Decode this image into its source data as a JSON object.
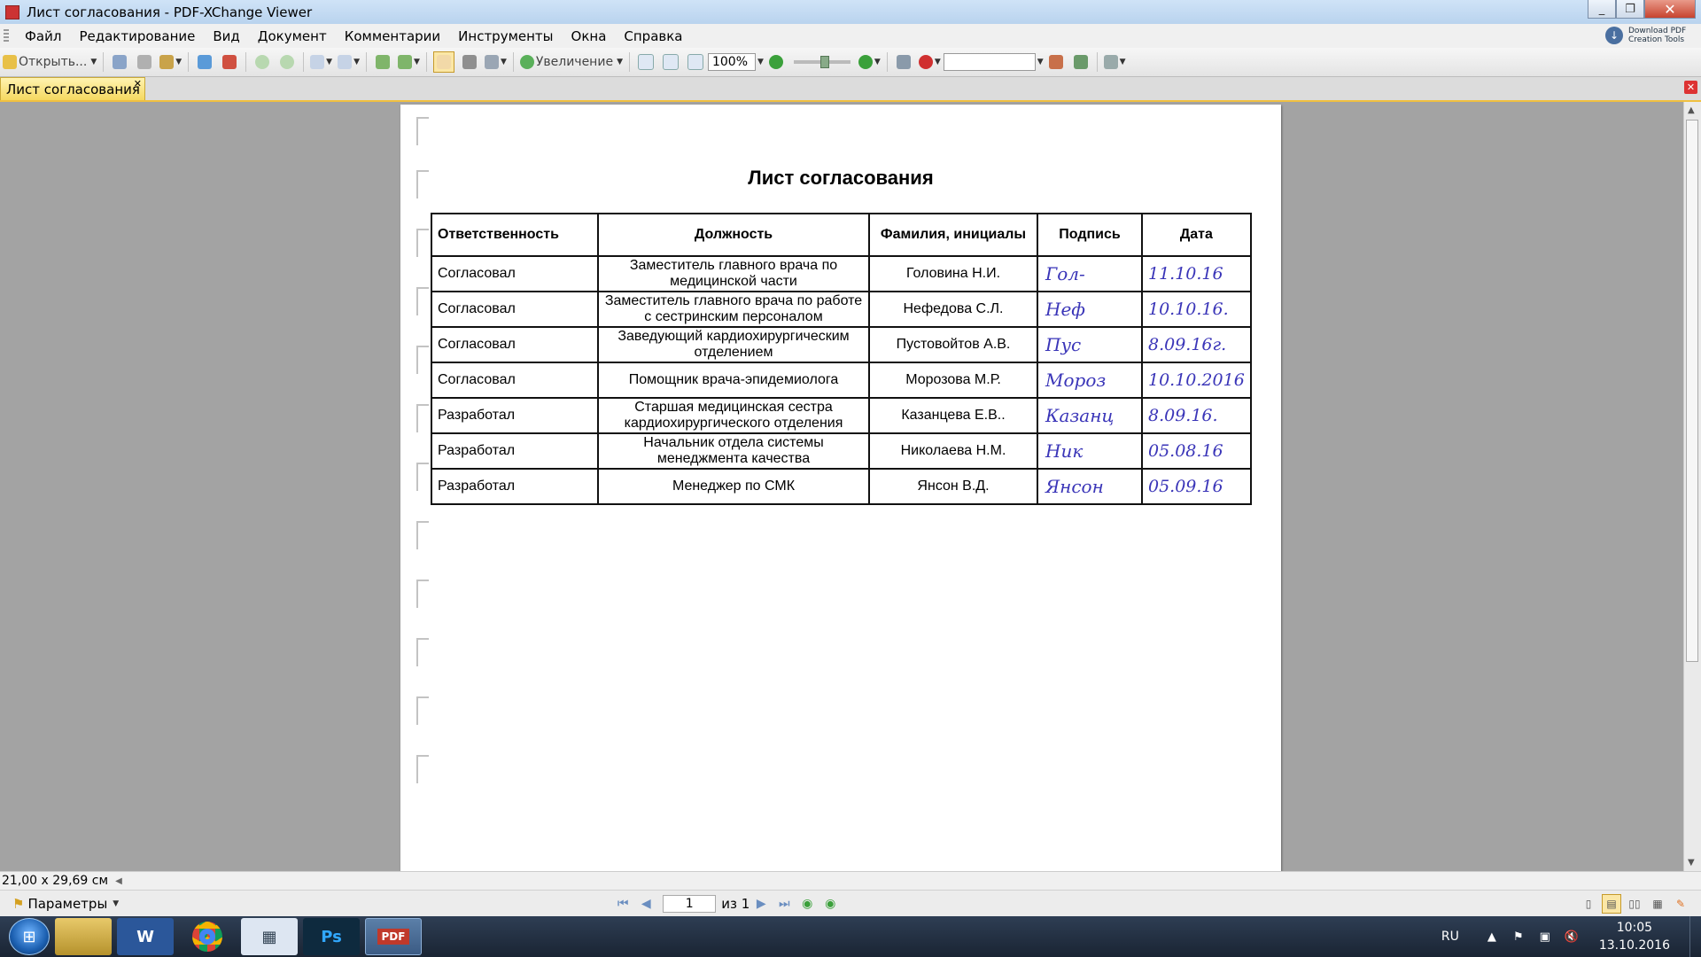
{
  "window": {
    "title": "Лист согласования - PDF-XChange Viewer"
  },
  "menu": [
    "Файл",
    "Редактирование",
    "Вид",
    "Документ",
    "Комментарии",
    "Инструменты",
    "Окна",
    "Справка"
  ],
  "download_promo": [
    "Download PDF",
    "Creation Tools"
  ],
  "toolbar": {
    "open_label": "Открыть...",
    "zoom_in_label": "Увеличение",
    "zoom_value": "100%"
  },
  "tab": {
    "label": "Лист согласования"
  },
  "document": {
    "title": "Лист согласования",
    "headers": [
      "Ответственность",
      "Должность",
      "Фамилия, инициалы",
      "Подпись",
      "Дата"
    ],
    "rows": [
      {
        "role": "Согласовал",
        "position": "Заместитель главного врача по медицинской части",
        "name": "Головина Н.И.",
        "signature": "Гол-",
        "date": "11.10.16"
      },
      {
        "role": "Согласовал",
        "position": "Заместитель главного врача по работе с сестринским персоналом",
        "name": "Нефедова С.Л.",
        "signature": "Неф",
        "date": "10.10.16."
      },
      {
        "role": "Согласовал",
        "position": "Заведующий кардиохирургическим отделением",
        "name": "Пустовойтов А.В.",
        "signature": "Пус",
        "date": "8.09.16г."
      },
      {
        "role": "Согласовал",
        "position": "Помощник врача-эпидемиолога",
        "name": "Морозова М.Р.",
        "signature": "Мороз",
        "date": "10.10.2016"
      },
      {
        "role": "Разработал",
        "position": "Старшая медицинская сестра кардиохирургического отделения",
        "name": "Казанцева Е.В..",
        "signature": "Казанц",
        "date": "8.09.16."
      },
      {
        "role": "Разработал",
        "position": "Начальник отдела системы менеджмента качества",
        "name": "Николаева Н.М.",
        "signature": "Ник",
        "date": "05.08.16"
      },
      {
        "role": "Разработал",
        "position": "Менеджер по СМК",
        "name": "Янсон В.Д.",
        "signature": "Янсон",
        "date": "05.09.16"
      }
    ]
  },
  "status": {
    "page_size": "21,00 x 29,69 см",
    "params_label": "Параметры",
    "page_number": "1",
    "page_of": "из 1"
  },
  "taskbar": {
    "apps": [
      "Explorer",
      "W",
      "Chrome",
      "App",
      "Ps",
      "PDF"
    ],
    "lang": "RU",
    "time": "10:05",
    "date": "13.10.2016"
  },
  "colors": {
    "tab_accent": "#f0c040",
    "ink": "#3a35b8",
    "taskbar": "#1a2433"
  }
}
